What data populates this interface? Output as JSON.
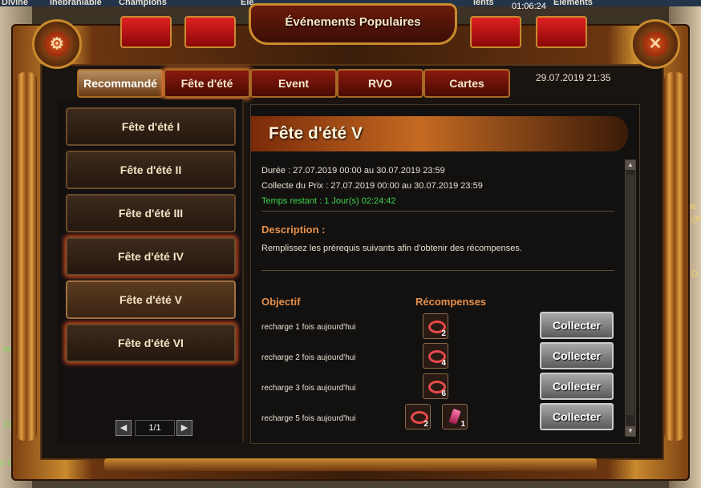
{
  "background": {
    "top_items": [
      "Divine",
      "Inébranlable",
      "Champions",
      "Élé",
      "lents",
      "Éléments"
    ],
    "top_timer": "01:06:24",
    "left_texts": [
      "meil",
      "Céle",
      "n Ce"
    ],
    "right_texts": [
      "he",
      "an]R",
      "D"
    ]
  },
  "window": {
    "title": "Événements Populaires",
    "datetime": "29.07.2019 21:35",
    "settings_icon": "gear-icon",
    "close_icon": "close-icon",
    "close_glyph": "✕",
    "settings_glyph": "⚙"
  },
  "tabs": [
    {
      "label": "Recommandé",
      "active": true
    },
    {
      "label": "Fête d'été",
      "active": false
    },
    {
      "label": "Event",
      "active": false
    },
    {
      "label": "RVO",
      "active": false
    },
    {
      "label": "Cartes",
      "active": false
    }
  ],
  "event_list": [
    {
      "label": "Fête d'été I"
    },
    {
      "label": "Fête d'été II"
    },
    {
      "label": "Fête d'été III"
    },
    {
      "label": "Fête d'été IV"
    },
    {
      "label": "Fête d'été V"
    },
    {
      "label": "Fête d'été VI"
    }
  ],
  "pager": {
    "prev": "◀",
    "page": "1/1",
    "next": "▶"
  },
  "detail": {
    "title": "Fête d'été V",
    "duration": "Durée : 27.07.2019 00:00 au 30.07.2019 23:59",
    "collect_period": "Collecte du Prix : 27.07.2019 00:00 au 30.07.2019 23:59",
    "remaining": "Temps restant : 1 Jour(s)  02:24:42",
    "description_title": "Description :",
    "description": "Remplissez les prérequis suivants afin d'obtenir des récompenses.",
    "objective_header": "Objectif",
    "rewards_header": "Récompenses",
    "rows": [
      {
        "objective": "recharge 1 fois aujourd'hui",
        "rewards": [
          {
            "icon": "ring-icon",
            "qty": "2"
          }
        ],
        "button": "Collecter"
      },
      {
        "objective": "recharge 2 fois aujourd'hui",
        "rewards": [
          {
            "icon": "ring-icon",
            "qty": "4"
          }
        ],
        "button": "Collecter"
      },
      {
        "objective": "recharge 3 fois aujourd'hui",
        "rewards": [
          {
            "icon": "ring-icon",
            "qty": "6"
          }
        ],
        "button": "Collecter"
      },
      {
        "objective": "recharge 5 fois aujourd'hui",
        "rewards": [
          {
            "icon": "ring-icon",
            "qty": "2"
          },
          {
            "icon": "gem-icon",
            "qty": "1"
          }
        ],
        "button": "Collecter"
      }
    ]
  },
  "colors": {
    "accent": "#e8904a",
    "green": "#3fd24a",
    "tab_red": "#8a1a0c"
  }
}
